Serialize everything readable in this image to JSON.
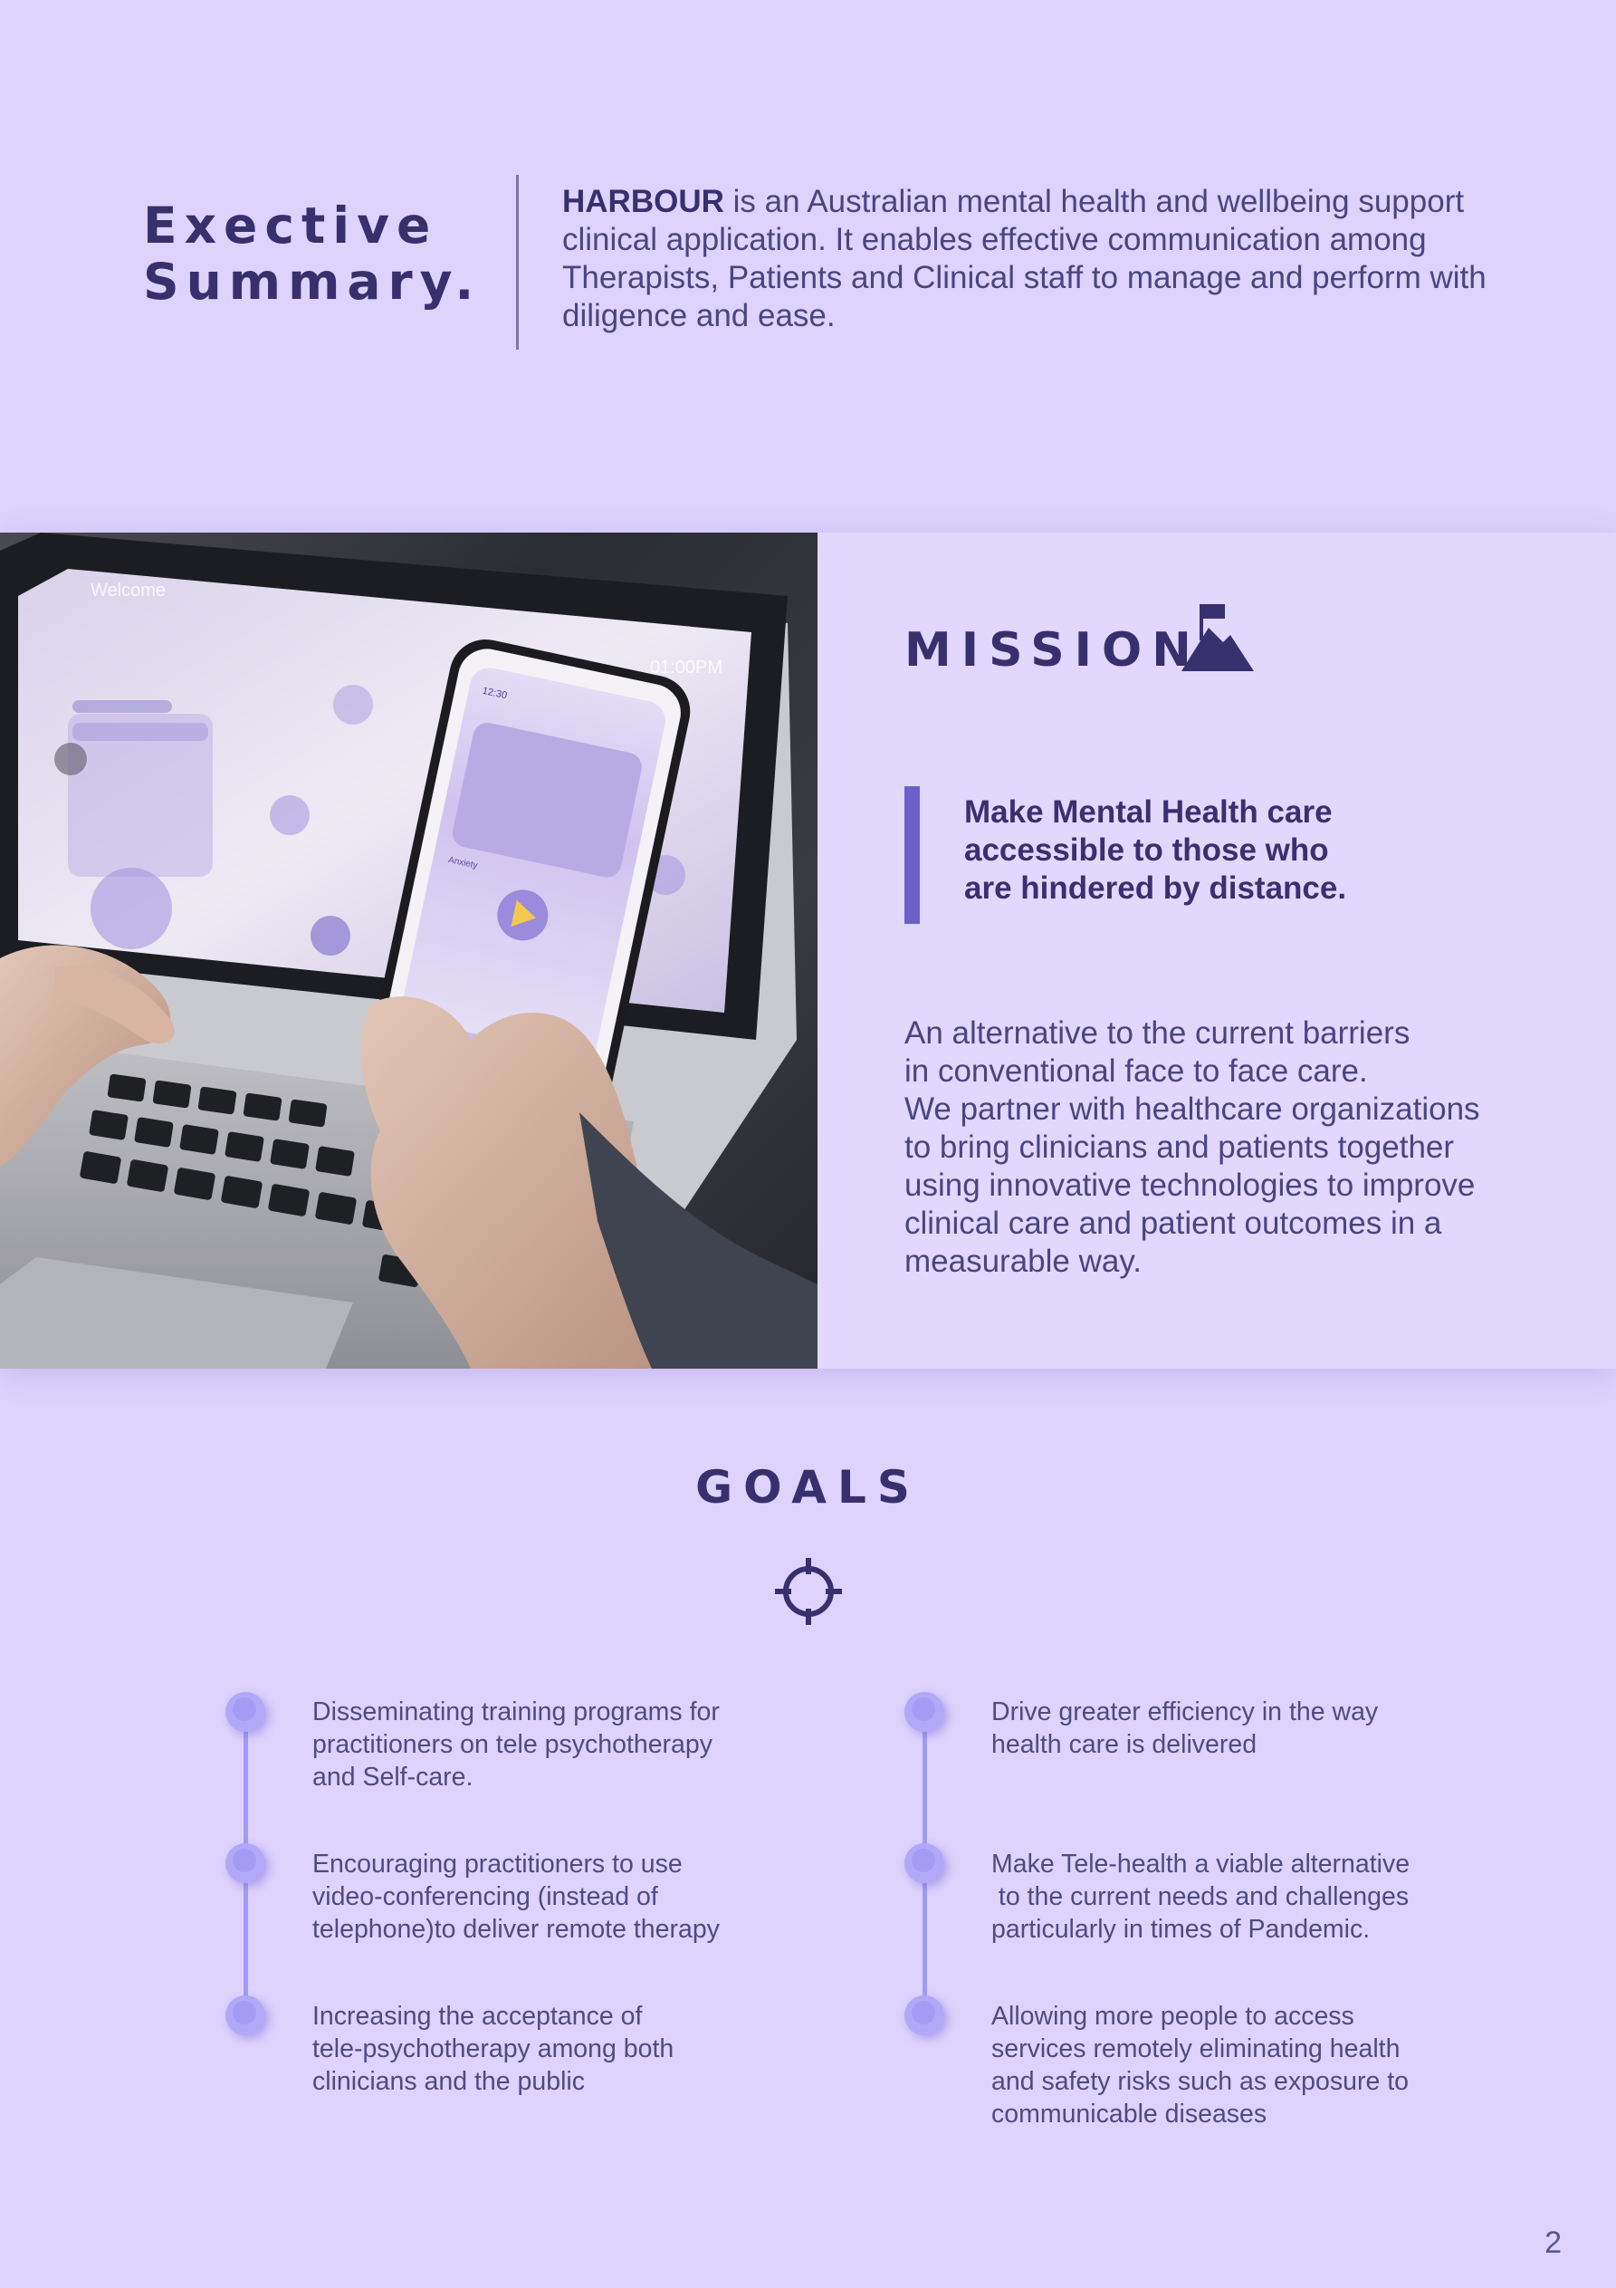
{
  "executive_summary": {
    "title_line1": "Exective",
    "title_line2": "Summary.",
    "brand": "HARBOUR",
    "text": " is an Australian mental health and wellbeing support clinical application. It enables effective communication among Therapists, Patients and Clinical staff to manage and perform with diligence and ease."
  },
  "mission": {
    "title": "MISSION",
    "icon": "mountain-flag-icon",
    "quote": "Make Mental Health care accessible to those who are hindered by distance.",
    "body_lines": [
      "An alternative to the current barriers",
      "in conventional face to face care.",
      "We partner with healthcare organizations",
      "to bring clinicians and patients together",
      "using innovative technologies to improve",
      "clinical care and patient outcomes in a",
      "measurable way."
    ],
    "phone_screen": {
      "time": "12:30",
      "label": "Anxiety"
    },
    "laptop_screen": {
      "greeting": "Welcome",
      "time": "01:00PM"
    }
  },
  "goals": {
    "title": "GOALS",
    "icon": "crosshair-target-icon",
    "left": [
      [
        "Disseminating training programs for",
        "practitioners on tele psychotherapy",
        "and Self-care."
      ],
      [
        "Encouraging practitioners to use",
        "video-conferencing (instead of",
        "telephone)to deliver remote therapy"
      ],
      [
        "Increasing the acceptance of",
        "tele-psychotherapy among both",
        "clinicians and the public"
      ]
    ],
    "right": [
      [
        "Drive greater efficiency in the way",
        "health care is delivered"
      ],
      [
        "Make Tele-health a viable alternative",
        " to the current needs and challenges",
        "particularly in times of Pandemic."
      ],
      [
        "Allowing more people to access",
        "services remotely eliminating health",
        "and safety risks such as exposure to",
        "communicable diseases"
      ]
    ]
  },
  "page_number": "2",
  "colors": {
    "background": "#ddd3fd",
    "panel": "#e2d7fd",
    "heading": "#38306d",
    "accent": "#6b60c9",
    "timeline": "#a39bf2"
  }
}
